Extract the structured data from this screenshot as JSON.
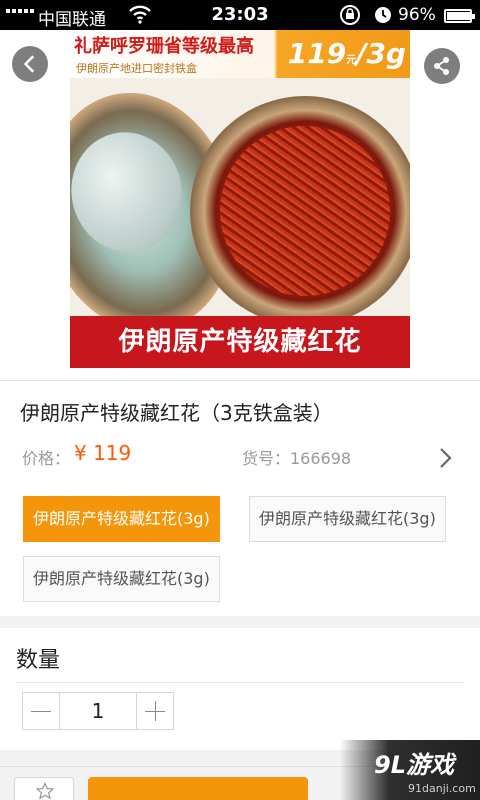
{
  "status_bar": {
    "carrier": "中国联通",
    "time": "23:03",
    "battery_percent": "96%",
    "battery_level": 0.96
  },
  "hero": {
    "promo_title": "礼萨呼罗珊省等级最高",
    "promo_subtitle": "伊朗原产地进口密封铁盒",
    "promo_price_value": "119",
    "promo_price_unit": "元",
    "promo_price_suffix": "/3g",
    "product_title_strip": "伊朗原产特级藏红花"
  },
  "product": {
    "name": "伊朗原产特级藏红花（3克铁盒装）",
    "price_label": "价格：",
    "price_value": "¥ 119",
    "sku_label": "货号：166698"
  },
  "specs": [
    {
      "label": "伊朗原产特级藏红花(3g)",
      "selected": true
    },
    {
      "label": "伊朗原产特级藏红花(3g)",
      "selected": false
    },
    {
      "label": "伊朗原产特级藏红花(3g)",
      "selected": false
    }
  ],
  "quantity": {
    "title": "数量",
    "value": "1"
  },
  "watermark": {
    "logo": "9L游戏",
    "url": "91danji.com"
  },
  "colors": {
    "accent": "#f5960a",
    "price": "#ff5a00",
    "strip_red": "#c8161d"
  }
}
